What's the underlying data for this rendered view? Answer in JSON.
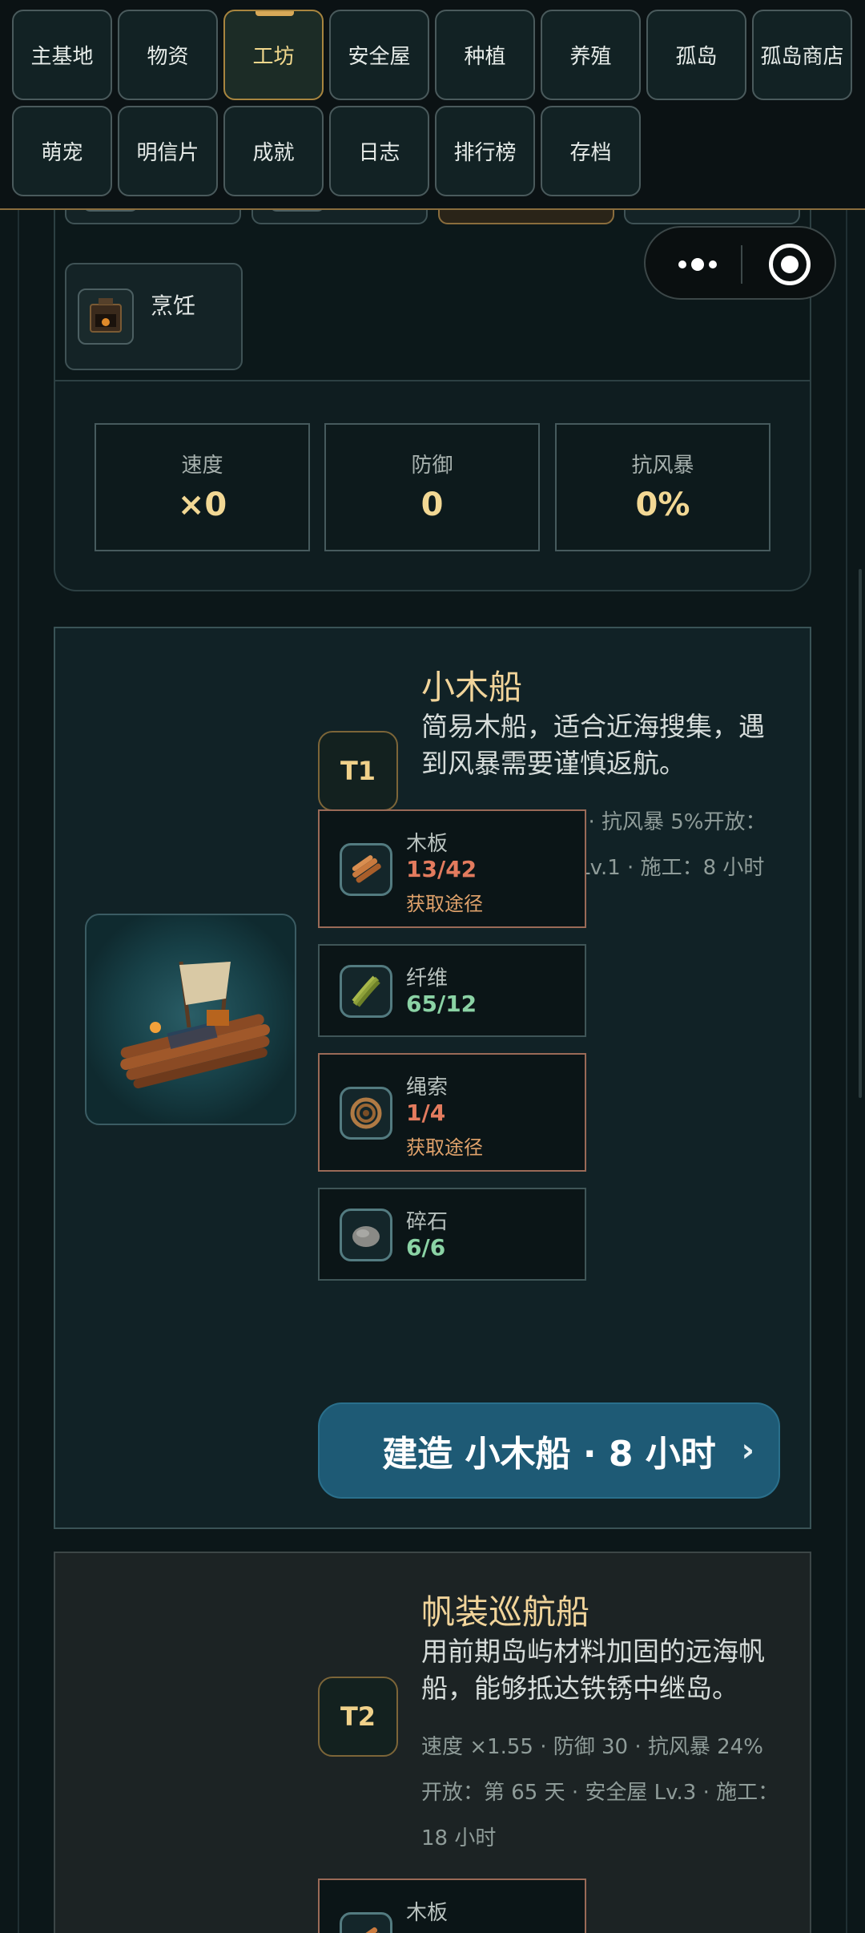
{
  "nav": {
    "row1": [
      "主基地",
      "物资",
      "工坊",
      "安全屋",
      "种植",
      "养殖",
      "孤岛",
      "孤岛商店"
    ],
    "row2": [
      "萌宠",
      "明信片",
      "成就",
      "日志",
      "排行榜",
      "存档"
    ],
    "active": "工坊"
  },
  "facility": {
    "cooking_label": "烹饪",
    "stats": [
      {
        "label": "速度",
        "value": "×0"
      },
      {
        "label": "防御",
        "value": "0"
      },
      {
        "label": "抗风暴",
        "value": "0%"
      }
    ]
  },
  "boats": [
    {
      "tier": "T1",
      "name": "小木船",
      "description": "简易木船，适合近海搜集，遇到风暴需要谨慎返航。",
      "meta": "速度 ×1 · 防御 0 · 抗风暴 5%开放：第 1 天 · 安全屋 Lv.1 · 施工：8 小时",
      "materials": [
        {
          "name": "木板",
          "qty": "13/42",
          "source": "获取途径",
          "icon": "planks-icon",
          "status": "short"
        },
        {
          "name": "纤维",
          "qty": "65/12",
          "icon": "fiber-icon",
          "status": "ok"
        },
        {
          "name": "绳索",
          "qty": "1/4",
          "source": "获取途径",
          "icon": "rope-icon",
          "status": "short"
        },
        {
          "name": "碎石",
          "qty": "6/6",
          "icon": "gravel-icon",
          "status": "ok"
        }
      ],
      "build_label": "建造 小木船 · 8 小时",
      "build_chevron": "›"
    },
    {
      "tier": "T2",
      "name": "帆装巡航船",
      "description": "用前期岛屿材料加固的远海帆船，能够抵达铁锈中继岛。",
      "meta": "速度 ×1.55 · 防御 30 · 抗风暴 24%开放：第 65 天 · 安全屋 Lv.3 · 施工：18 小时",
      "materials": [
        {
          "name": "木板",
          "icon": "planks-icon"
        }
      ]
    }
  ],
  "colors": {
    "accent_gold": "#f1d49a",
    "build_button": "#1e5a75",
    "shortage": "#e37b5e",
    "sufficient": "#8bd3a5"
  }
}
